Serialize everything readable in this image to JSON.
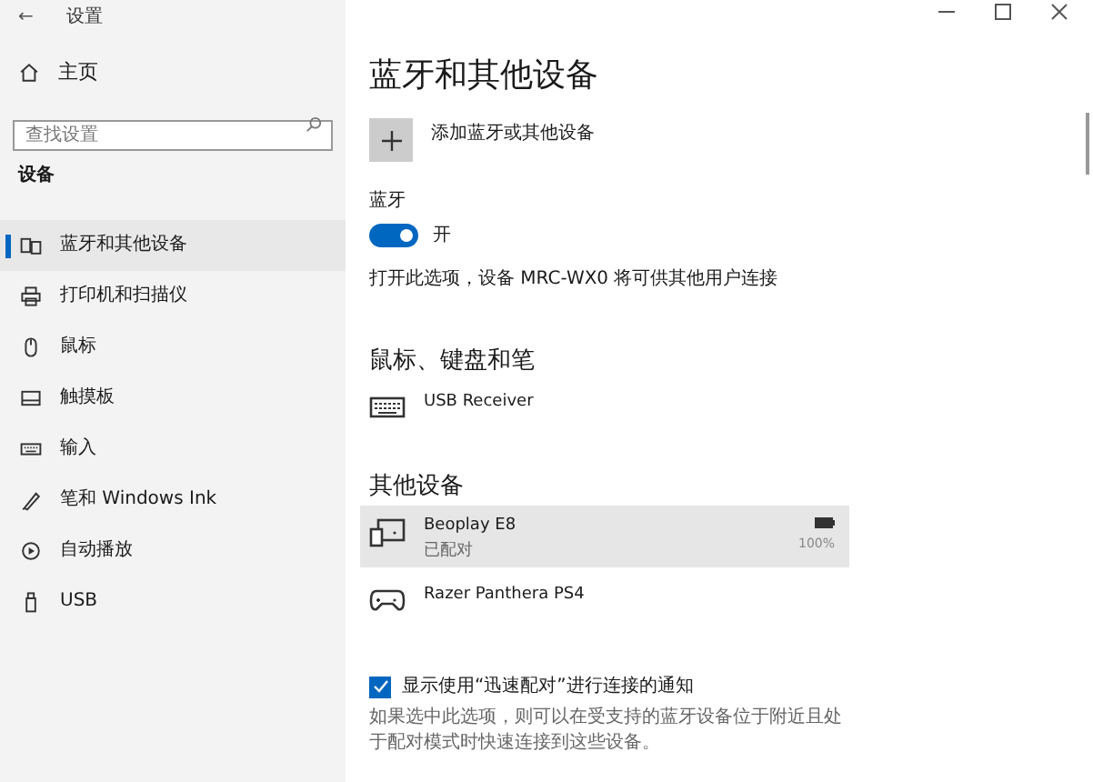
{
  "window": {
    "title": "设置",
    "back": "←"
  },
  "sidebar": {
    "home": "主页",
    "search": {
      "placeholder": "查找设置"
    },
    "section": "设备",
    "items": [
      {
        "label": "蓝牙和其他设备",
        "kind": "bluetooth",
        "selected": true
      },
      {
        "label": "打印机和扫描仪",
        "kind": "printer",
        "selected": false
      },
      {
        "label": "鼠标",
        "kind": "mouse",
        "selected": false
      },
      {
        "label": "触摸板",
        "kind": "touchpad",
        "selected": false
      },
      {
        "label": "输入",
        "kind": "keyboard",
        "selected": false
      },
      {
        "label": "笔和 Windows Ink",
        "kind": "pen",
        "selected": false
      },
      {
        "label": "自动播放",
        "kind": "autoplay",
        "selected": false
      },
      {
        "label": "USB",
        "kind": "usb",
        "selected": false
      }
    ]
  },
  "main": {
    "title": "蓝牙和其他设备",
    "add_device": "添加蓝牙或其他设备",
    "bluetooth": {
      "label": "蓝牙",
      "on": true,
      "state_label": "开",
      "note": "打开此选项，设备 MRC-WX0 将可供其他用户连接"
    },
    "groups": [
      {
        "heading": "鼠标、键盘和笔",
        "devices": [
          {
            "name": "USB Receiver",
            "kind": "keyboard",
            "selected": false
          }
        ]
      },
      {
        "heading": "其他设备",
        "devices": [
          {
            "name": "Beoplay E8",
            "status": "已配对",
            "kind": "device",
            "battery": "100%",
            "selected": true
          },
          {
            "name": "Razer Panthera PS4",
            "kind": "gamepad",
            "selected": false
          }
        ]
      }
    ],
    "swift_pair": {
      "label": "显示使用“迅速配对”进行连接的通知",
      "checked": true,
      "description": "如果选中此选项，则可以在受支持的蓝牙设备位于附近且处于配对模式时快速连接到这些设备。"
    }
  }
}
